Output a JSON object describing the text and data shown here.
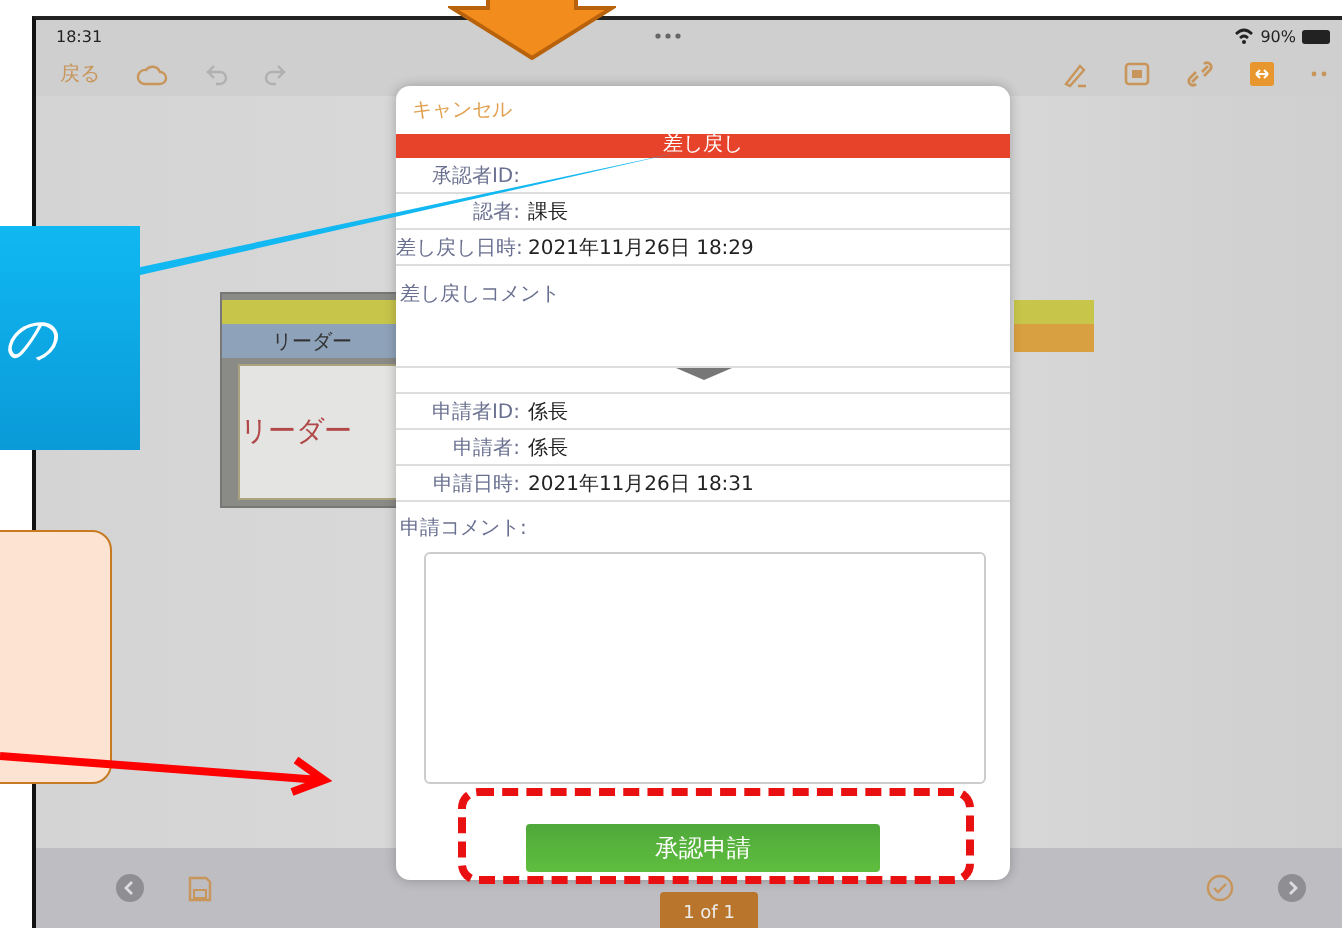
{
  "status_bar": {
    "time": "18:31",
    "battery": "90%"
  },
  "toolbar": {
    "back": "戻る"
  },
  "document": {
    "header_label": "リーダー",
    "body_text": "リーダー"
  },
  "dialog": {
    "cancel": "キャンセル",
    "banner": "差し戻し",
    "approver_rows": [
      {
        "label": "承認者ID:"
      },
      {
        "label": "認者:",
        "value": "課長"
      },
      {
        "label": "差し戻し日時:",
        "value": "2021年11月26日 18:29"
      }
    ],
    "return_comment_label": "差し戻しコメント",
    "applicant_rows": [
      {
        "label": "申請者ID:",
        "value": "係長"
      },
      {
        "label": "申請者:",
        "value": "係長"
      },
      {
        "label": "申請日時:",
        "value": "2021年11月26日 18:31"
      }
    ],
    "comment_label": "申請コメント:",
    "submit": "承認申請"
  },
  "bottom_bar": {
    "page_indicator": "1 of 1"
  },
  "annotations": {
    "callout_text": "の"
  }
}
